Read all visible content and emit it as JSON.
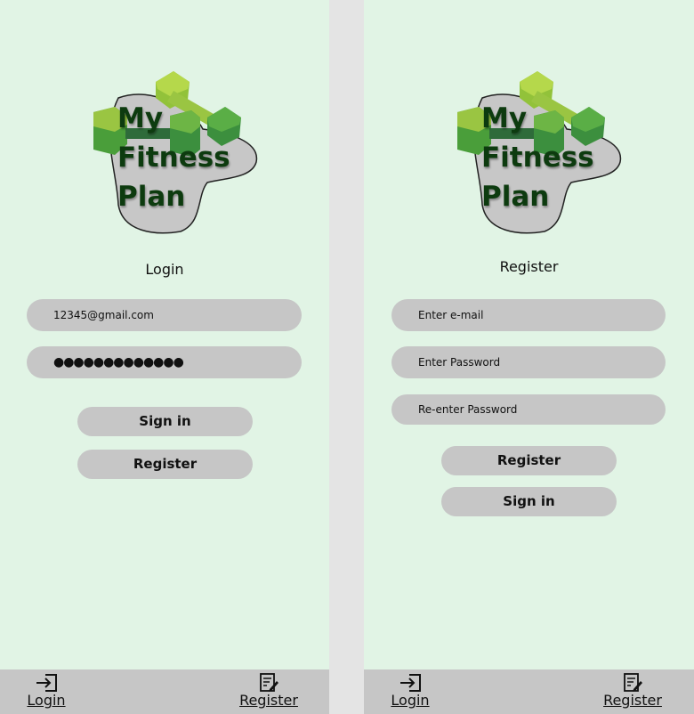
{
  "logo": {
    "line1": "My",
    "line2": "Fitness",
    "line3": "Plan"
  },
  "login_screen": {
    "heading": "Login",
    "email_value": "12345@gmail.com",
    "password_value": "●●●●●●●●●●●●●",
    "signin_label": "Sign in",
    "register_label": "Register"
  },
  "register_screen": {
    "heading": "Register",
    "email_placeholder": "Enter e-mail",
    "password_placeholder": "Enter Password",
    "reenter_placeholder": "Re-enter Password",
    "register_label": "Register",
    "signin_label": "Sign in"
  },
  "tabbar": {
    "login_label": "Login",
    "register_label": "Register"
  },
  "colors": {
    "background": "#e1f4e5",
    "control": "#c6c6c6",
    "logo_text": "#0d3b0f"
  }
}
